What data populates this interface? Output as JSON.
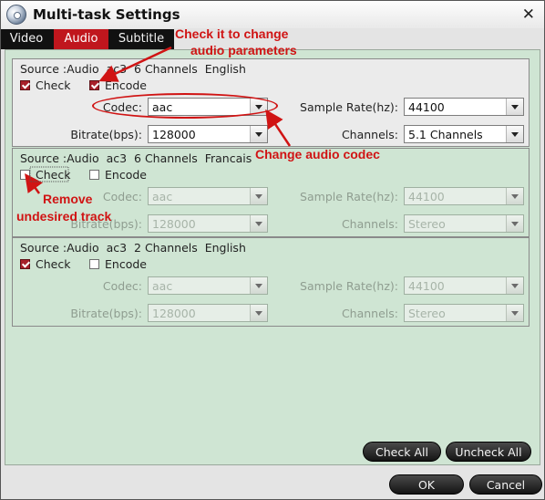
{
  "window": {
    "title": "Multi-task Settings",
    "close_glyph": "✕"
  },
  "tabs": [
    {
      "label": "Video"
    },
    {
      "label": "Audio"
    },
    {
      "label": "Subtitle"
    }
  ],
  "labels": {
    "check": "Check",
    "encode": "Encode",
    "codec": "Codec:",
    "sample_rate": "Sample Rate(hz):",
    "bitrate": "Bitrate(bps):",
    "channels": "Channels:"
  },
  "tracks": [
    {
      "source": "Source :Audio  ac3  6 Channels  English",
      "check": true,
      "encode": true,
      "codec": "aac",
      "sample_rate": "44100",
      "bitrate": "128000",
      "channels": "5.1 Channels",
      "enabled": true
    },
    {
      "source": "Source :Audio  ac3  6 Channels  Francais",
      "check": false,
      "encode": false,
      "codec": "aac",
      "sample_rate": "44100",
      "bitrate": "128000",
      "channels": "Stereo",
      "enabled": false
    },
    {
      "source": "Source :Audio  ac3  2 Channels  English",
      "check": true,
      "encode": false,
      "codec": "aac",
      "sample_rate": "44100",
      "bitrate": "128000",
      "channels": "Stereo",
      "enabled": false
    }
  ],
  "buttons": {
    "check_all": "Check All",
    "uncheck_all": "Uncheck All",
    "ok": "OK",
    "cancel": "Cancel"
  },
  "annotations": {
    "encode_note_line1": "Check it to change",
    "encode_note_line2": "audio parameters",
    "codec_note": "Change audio codec",
    "remove_note_line1": "Remove",
    "remove_note_line2": "undesired track"
  },
  "colors": {
    "accent": "#c0161d",
    "annotation": "#d01414",
    "panel": "#cfe5d3"
  },
  "icons": {
    "app": "disc-icon",
    "close": "close-icon"
  }
}
